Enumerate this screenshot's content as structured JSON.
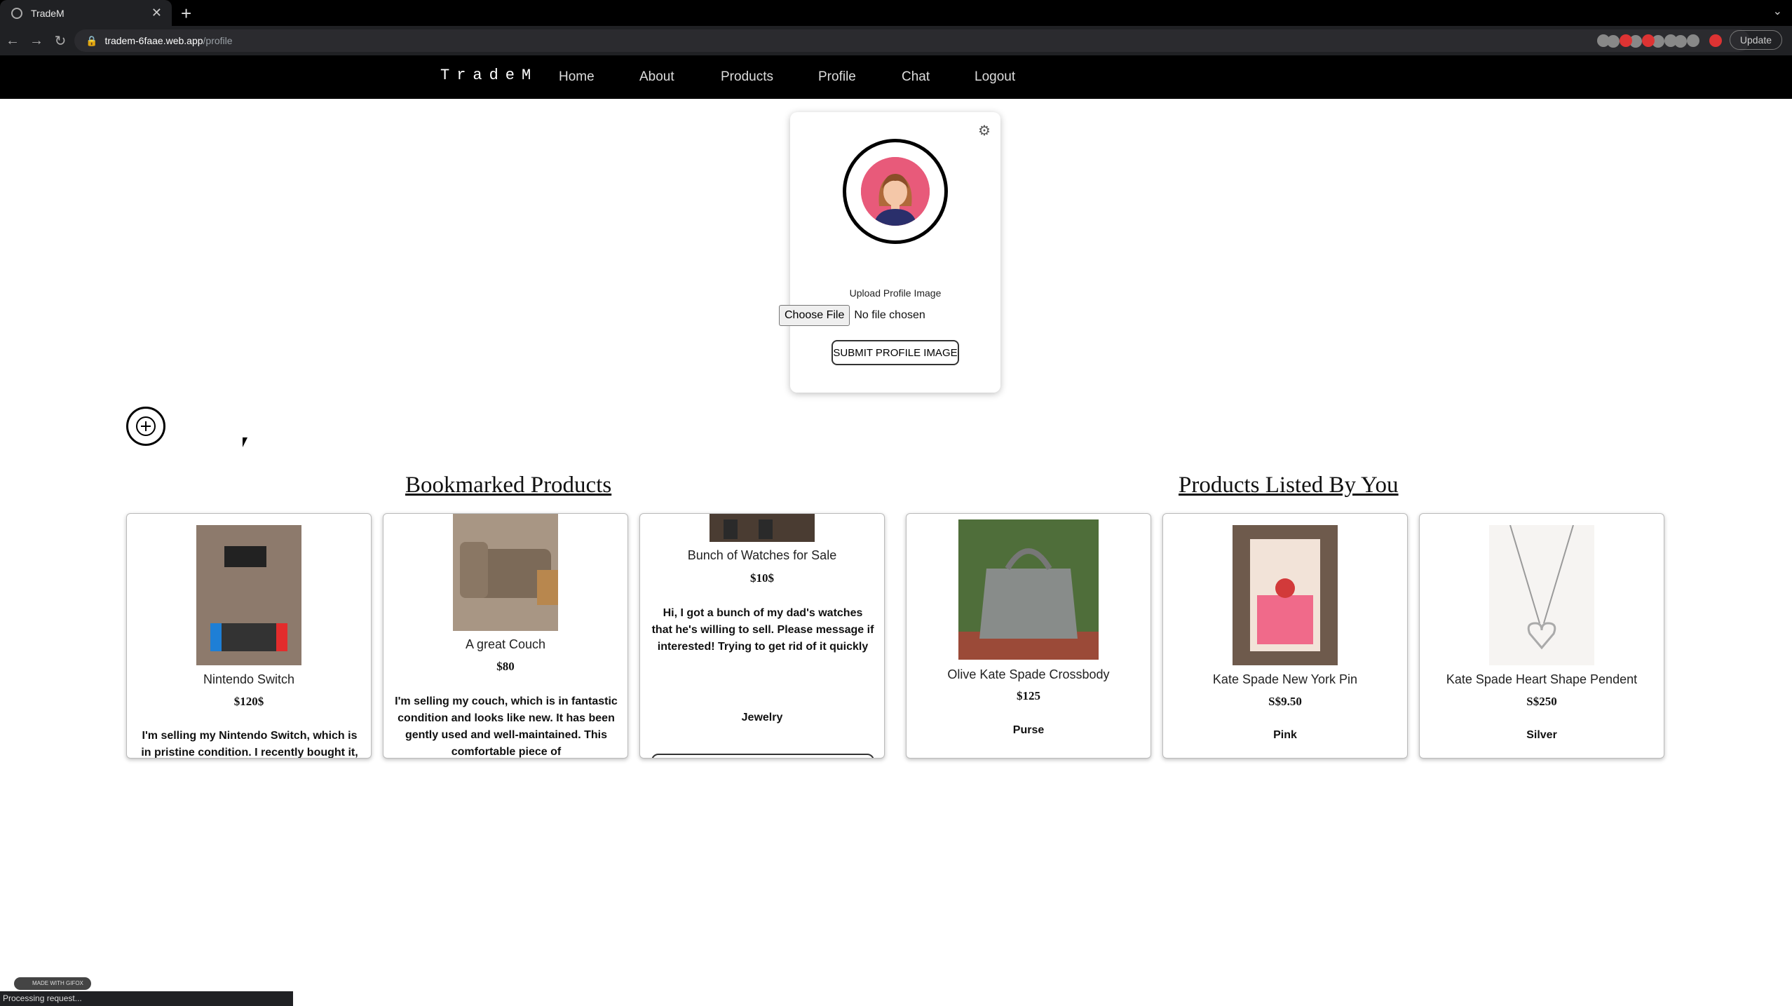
{
  "browser": {
    "tab_title": "TradeM",
    "url_host": "tradem-6faae.web.app",
    "url_path": "/profile",
    "update_label": "Update",
    "status_text": "Processing request..."
  },
  "nav": {
    "brand": "TradeM",
    "links": [
      "Home",
      "About",
      "Products",
      "Profile",
      "Chat",
      "Logout"
    ]
  },
  "profile": {
    "upload_label": "Upload Profile Image",
    "choose_file_label": "Choose File",
    "no_file_text": "No file chosen",
    "submit_label": "SUBMIT PROFILE IMAGE"
  },
  "bookmarked": {
    "title": "Bookmarked Products",
    "items": [
      {
        "name": "Nintendo Switch",
        "price": "$120$",
        "description": "I'm selling my Nintendo Switch, which is in pristine condition. I recently bought it,"
      },
      {
        "name": "A great Couch",
        "price": "$80",
        "description": "I'm selling my couch, which is in fantastic condition and looks like new. It has been gently used and well-maintained. This comfortable piece of"
      },
      {
        "name": "Bunch of Watches for Sale",
        "price": "$10$",
        "description": "Hi, I got a bunch of my dad's watches that he's willing to sell. Please message if interested! Trying to get rid of it quickly",
        "category": "Jewelry"
      }
    ]
  },
  "listed": {
    "title": "Products Listed By You",
    "items": [
      {
        "name": "Olive Kate Spade Crossbody",
        "price": "$125",
        "category": "Purse"
      },
      {
        "name": "Kate Spade New York Pin",
        "price": "S$9.50",
        "category": "Pink"
      },
      {
        "name": "Kate Spade Heart Shape Pendent",
        "price": "S$250",
        "category": "Silver"
      }
    ]
  },
  "misc": {
    "gifox_label": "MADE WITH GIFOX"
  }
}
